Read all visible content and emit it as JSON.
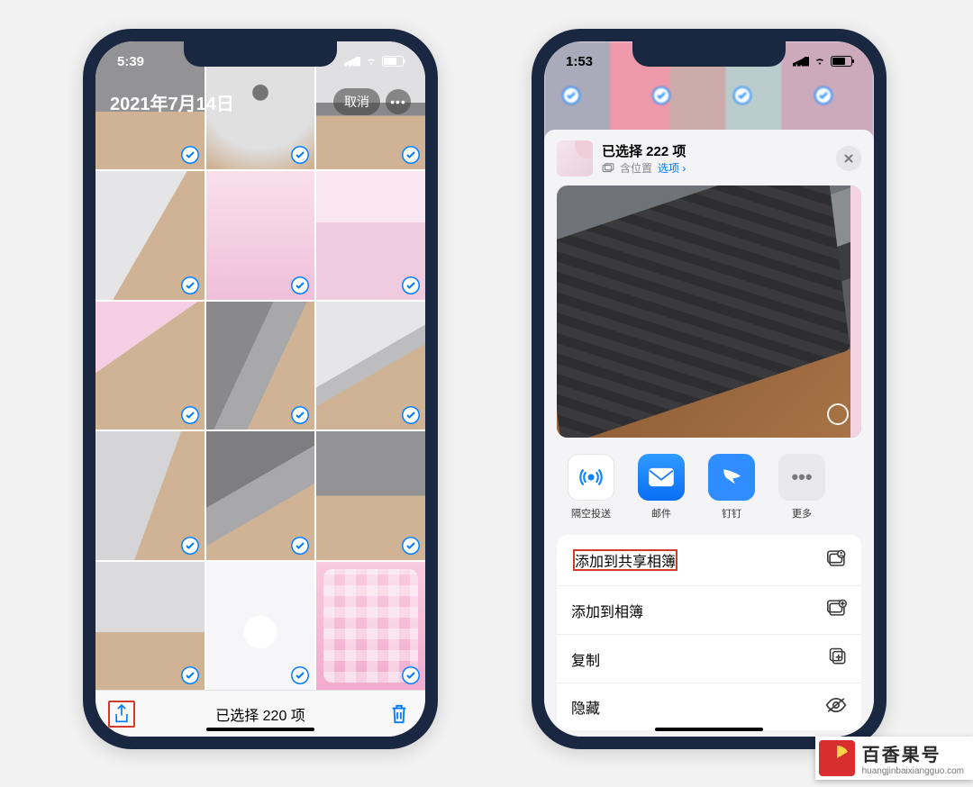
{
  "left": {
    "status_time": "5:39",
    "header_date": "2021年7月14日",
    "cancel_label": "取消",
    "selected_count_label": "已选择 220 项"
  },
  "right": {
    "status_time": "1:53",
    "sheet_title": "已选择 222 项",
    "sheet_sub_location": "含位置",
    "sheet_sub_options": "选项",
    "apps": {
      "airdrop": "隔空投送",
      "mail": "邮件",
      "dingtalk": "钉钉",
      "more": "更多"
    },
    "actions": {
      "add_shared_album": "添加到共享相簿",
      "add_album": "添加到相簿",
      "copy": "复制",
      "hide": "隐藏"
    }
  },
  "watermark": {
    "title": "百香果号",
    "url": "huangjinbaixiangguo.com"
  }
}
